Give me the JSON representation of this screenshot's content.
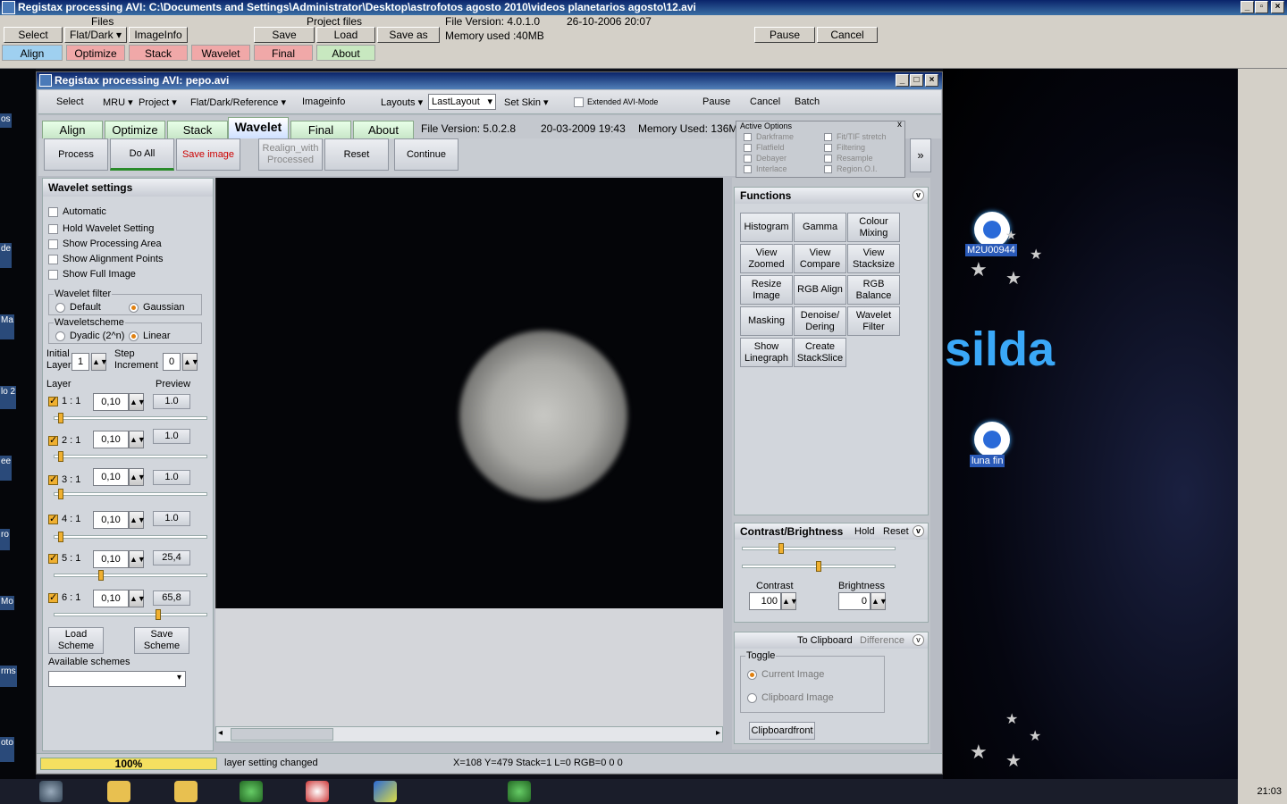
{
  "outer": {
    "title": "Registax processing AVI: C:\\Documents and Settings\\Administrator\\Desktop\\astrofotos agosto 2010\\videos planetarios agosto\\12.avi",
    "files_label": "Files",
    "project_files_label": "Project files",
    "file_version": "File Version: 4.0.1.0",
    "date": "26-10-2006 20:07",
    "memory": "Memory used :40MB",
    "buttons": {
      "select": "Select",
      "flatdark": "Flat/Dark ▾",
      "imageinfo": "ImageInfo",
      "save": "Save",
      "load": "Load",
      "saveas": "Save as",
      "pause": "Pause",
      "cancel": "Cancel"
    },
    "tabs": [
      "Align",
      "Optimize",
      "Stack",
      "Wavelet",
      "Final",
      "About"
    ]
  },
  "win": {
    "title": "Registax processing AVI: pepo.avi",
    "menu": {
      "select": "Select",
      "mru": "MRU ▾",
      "project": "Project ▾",
      "flat": "Flat/Dark/Reference ▾",
      "imageinfo": "Imageinfo",
      "layouts": "Layouts ▾",
      "layout_value": "LastLayout",
      "setskin": "Set Skin ▾",
      "extended": "Extended AVI-Mode",
      "pause": "Pause",
      "cancel": "Cancel",
      "batch": "Batch"
    },
    "tabs": [
      "Align",
      "Optimize",
      "Stack",
      "Wavelet",
      "Final",
      "About"
    ],
    "file_version": "File Version: 5.0.2.8",
    "date": "20-03-2009 19:43",
    "memory": "Memory Used: 136M",
    "process_buttons": {
      "process": "Process",
      "doall": "Do All",
      "save": "Save image",
      "realign": "Realign_with Processed",
      "reset": "Reset",
      "continue": "Continue"
    },
    "active_options": {
      "title": "Active Options",
      "items": [
        "Darkframe",
        "Flatfield",
        "Debayer",
        "Interlace",
        "Fit/TIF stretch",
        "Filtering",
        "Resample",
        "Region.O.I."
      ]
    }
  },
  "wavelet": {
    "header": "Wavelet settings",
    "checks": [
      "Automatic",
      "Hold Wavelet Setting",
      "Show Processing Area",
      "Show Alignment Points",
      "Show Full Image"
    ],
    "filter_label": "Wavelet filter",
    "filter_default": "Default",
    "filter_gaussian": "Gaussian",
    "scheme_label": "Waveletscheme",
    "scheme_dyadic": "Dyadic (2^n)",
    "scheme_linear": "Linear",
    "initial_layer_label": "Initial Layer",
    "initial_layer_value": "1",
    "step_label": "Step Increment",
    "step_value": "0",
    "layer_label": "Layer",
    "preview_label": "Preview",
    "layers": [
      {
        "name": "1 : 1",
        "value": "0,10",
        "preview": "1.0"
      },
      {
        "name": "2 : 1",
        "value": "0,10",
        "preview": "1.0"
      },
      {
        "name": "3 : 1",
        "value": "0,10",
        "preview": "1.0"
      },
      {
        "name": "4 : 1",
        "value": "0,10",
        "preview": "1.0"
      },
      {
        "name": "5 : 1",
        "value": "0,10",
        "preview": "25,4"
      },
      {
        "name": "6 : 1",
        "value": "0,10",
        "preview": "65,8"
      }
    ],
    "load_scheme": "Load Scheme",
    "save_scheme": "Save Scheme",
    "available": "Available schemes"
  },
  "functions": {
    "header": "Functions",
    "buttons": [
      "Histogram",
      "Gamma",
      "Colour Mixing",
      "View Zoomed",
      "View Compare",
      "View Stacksize",
      "Resize Image",
      "RGB Align",
      "RGB Balance",
      "Masking",
      "Denoise/ Dering",
      "Wavelet Filter",
      "Show Linegraph",
      "Create StackSlice"
    ]
  },
  "contrast": {
    "header": "Contrast/Brightness",
    "hold": "Hold",
    "reset": "Reset",
    "contrast_label": "Contrast",
    "contrast_value": "100",
    "brightness_label": "Brightness",
    "brightness_value": "0"
  },
  "clipboard": {
    "header": "To Clipboard",
    "difference": "Difference",
    "toggle": "Toggle",
    "current": "Current Image",
    "clip": "Clipboard Image",
    "front": "Clipboardfront"
  },
  "status": {
    "progress": "100%",
    "message": "layer setting changed",
    "coords": "X=108 Y=479 Stack=1 L=0 RGB=0 0 0"
  },
  "desktop": {
    "icon1": "M2U00944",
    "icon2": "luna fin",
    "brand": "silda",
    "clock": "21:03"
  }
}
